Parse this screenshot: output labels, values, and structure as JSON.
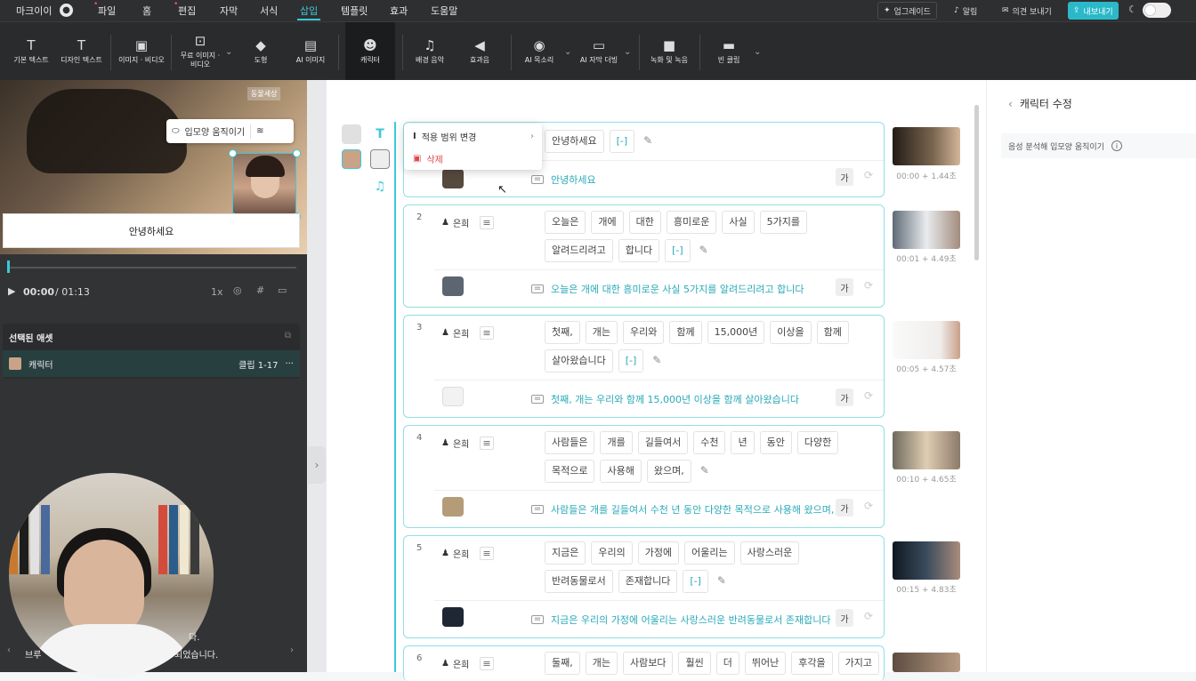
{
  "topbar": {
    "app": "마크이이",
    "menus": [
      "파일",
      "홈",
      "편집",
      "자막",
      "서식",
      "삽입",
      "템플릿",
      "효과",
      "도움말"
    ],
    "active_menu": "삽입",
    "upgrade": "업그레이드",
    "alarm": "알림",
    "feedback": "의견 보내기",
    "export": "내보내기"
  },
  "toolbar": {
    "tools": [
      {
        "label": "기본 텍스트",
        "icon": "T"
      },
      {
        "label": "디자인 텍스트",
        "icon": "T"
      },
      {
        "label": "이미지 · 비디오",
        "icon": "▣"
      },
      {
        "label": "무료 이미지 · 비디오",
        "icon": "⊡"
      },
      {
        "label": "도형",
        "icon": "◆"
      },
      {
        "label": "AI 이미지",
        "icon": "▤"
      },
      {
        "label": "캐릭터",
        "icon": "☻"
      },
      {
        "label": "배경 음악",
        "icon": "♫"
      },
      {
        "label": "효과음",
        "icon": "◀"
      },
      {
        "label": "AI 목소리",
        "icon": "◉"
      },
      {
        "label": "AI 자막 더빙",
        "icon": "▭"
      },
      {
        "label": "녹화 및 녹음",
        "icon": "■"
      },
      {
        "label": "빈 클립",
        "icon": "▬"
      }
    ]
  },
  "preview": {
    "overlay_label": "동물세상",
    "lip_sync_button": "입모양 움직이기",
    "subtitle": "안녕하세요",
    "time_current": "00:00",
    "time_total": "/ 01:13",
    "speed": "1x"
  },
  "assets": {
    "title": "선택된 애셋",
    "item_label": "캐릭터",
    "item_range": "클립 1-17",
    "more": "···"
  },
  "caption": {
    "line1": "다.",
    "line2": "브루",
    "line3": "되었습니다."
  },
  "dropdown": {
    "change_scope": "적용 범위 변경",
    "delete": "삭제"
  },
  "clips": [
    {
      "num": "",
      "speaker": "",
      "words": [
        "안녕하세요",
        "[-]"
      ],
      "sentence": "안녕하세요",
      "time": "00:00 + 1.44초"
    },
    {
      "num": "2",
      "speaker": "은희",
      "words": [
        "오늘은",
        "개에",
        "대한",
        "흥미로운",
        "사실",
        "5가지를",
        "알려드리려고",
        "합니다",
        "[-]"
      ],
      "sentence": "오늘은 개에 대한 흥미로운 사실 5가지를 알려드리려고 합니다",
      "time": "00:01 + 4.49초"
    },
    {
      "num": "3",
      "speaker": "은희",
      "words": [
        "첫째,",
        "개는",
        "우리와",
        "함께",
        "15,000년",
        "이상을",
        "함께",
        "살아왔습니다",
        "[-]"
      ],
      "sentence": "첫째, 개는 우리와 함께 15,000년 이상을 함께 살아왔습니다",
      "time": "00:05 + 4.57초"
    },
    {
      "num": "4",
      "speaker": "은희",
      "words": [
        "사람들은",
        "개를",
        "길들여서",
        "수천",
        "년",
        "동안",
        "다양한",
        "목적으로",
        "사용해",
        "왔으며,"
      ],
      "sentence": "사람들은 개를 길들여서 수천 년 동안 다양한 목적으로 사용해 왔으며,",
      "time": "00:10 + 4.65초"
    },
    {
      "num": "5",
      "speaker": "은희",
      "words": [
        "지금은",
        "우리의",
        "가정에",
        "어울리는",
        "사랑스러운",
        "반려동물로서",
        "존재합니다",
        "[-]"
      ],
      "sentence": "지금은 우리의 가정에 어울리는 사랑스러운 반려동물로서 존재합니다",
      "time": "00:15 + 4.83초"
    },
    {
      "num": "6",
      "speaker": "은희",
      "words": [
        "둘째,",
        "개는",
        "사람보다",
        "훨씬",
        "더",
        "뛰어난",
        "후각을",
        "가지고"
      ],
      "sentence": "",
      "time": ""
    }
  ],
  "ga_label": "가",
  "right_panel": {
    "title": "캐릭터 수정",
    "option": "음성 분석해 입모양 움직이기"
  },
  "colors": {
    "accent": "#3ec8d8",
    "topbar": "#2e2f31",
    "toolbar": "#2a2b2d",
    "export_btn": "#2bb9c9"
  }
}
